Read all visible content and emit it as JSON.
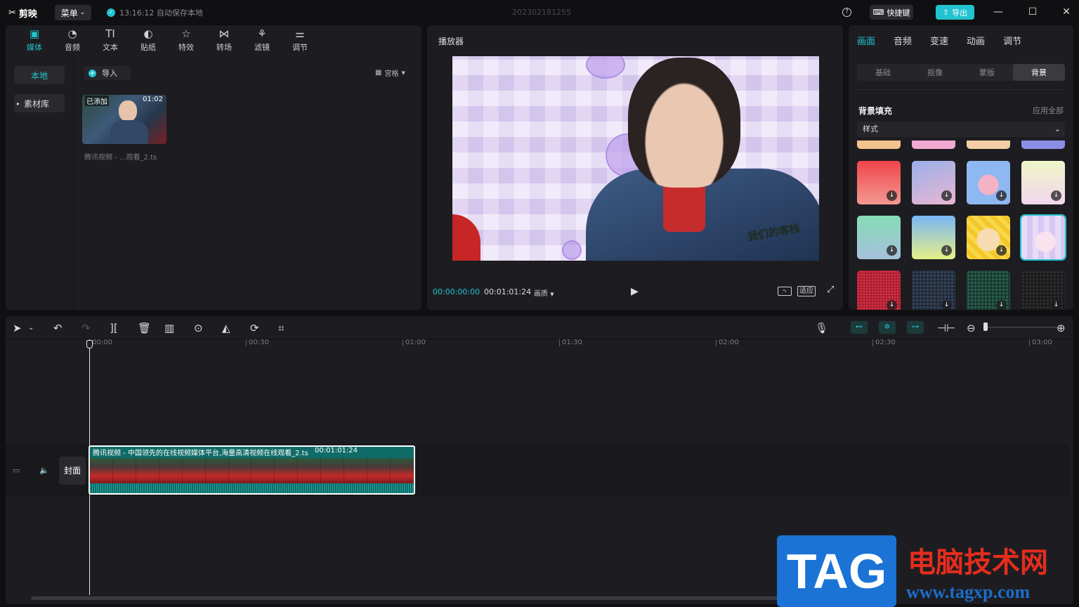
{
  "app": {
    "logo": "剪映",
    "menu_label": "菜单",
    "autosave_text": "13:16:12 自动保存本地",
    "project_name": "202302181255",
    "shortcut_label": "快捷键",
    "export_label": "导出"
  },
  "media": {
    "tools": [
      {
        "label": "媒体",
        "icon": "media-icon"
      },
      {
        "label": "音频",
        "icon": "audio-icon"
      },
      {
        "label": "文本",
        "icon": "text-icon"
      },
      {
        "label": "贴纸",
        "icon": "sticker-icon"
      },
      {
        "label": "特效",
        "icon": "effects-icon"
      },
      {
        "label": "转场",
        "icon": "transition-icon"
      },
      {
        "label": "滤镜",
        "icon": "filter-icon"
      },
      {
        "label": "调节",
        "icon": "adjust-icon"
      }
    ],
    "side_local": "本地",
    "side_library": "素材库",
    "import_label": "导入",
    "view_label": "宫格",
    "thumb_added": "已添加",
    "thumb_duration": "01:02",
    "thumb_name": "腾讯视频 - ...观看_2.ts"
  },
  "player": {
    "title": "播放器",
    "current_time": "00:00:00:00",
    "total_time": "00:01:01:24",
    "quality_label": "画质",
    "fit_label": "适应",
    "watermark": "我们的客栈"
  },
  "props": {
    "tabs": [
      "画面",
      "音频",
      "变速",
      "动画",
      "调节"
    ],
    "subtabs": [
      "基础",
      "抠像",
      "蒙版",
      "背景"
    ],
    "bg_fill_label": "背景填充",
    "apply_all_label": "应用全部",
    "style_select": "样式"
  },
  "timeline": {
    "ruler": [
      "00:00",
      "00:30",
      "01:00",
      "01:30",
      "02:00",
      "02:30",
      "03:00"
    ],
    "clip_title": "腾讯视频 - 中国领先的在线视频媒体平台,海量高清视频在线观看_2.ts",
    "clip_duration": "00:01:01:24",
    "cover_label": "封面"
  },
  "brand": {
    "tag": "TAG",
    "cn": "电脑技术网",
    "url": "www.tagxp.com"
  },
  "colors": {
    "accent": "#22c3d0",
    "panel": "#1d1d21",
    "bg": "#101012",
    "brand_blue": "#1b73d6",
    "brand_red": "#e52d1d"
  }
}
